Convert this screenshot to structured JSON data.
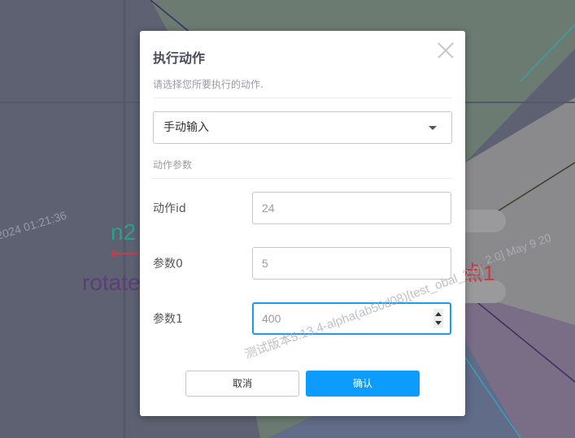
{
  "canvas": {
    "labels": {
      "n2": "n2",
      "rotate": "rotate",
      "point1": "点1",
      "arrow": "⟵"
    },
    "watermark_left": "2024 01:21:36",
    "watermark_right": "2.0] May 9 20",
    "watermark_center": "测试版本5.13.4-alpha(ab50d08)[test_obal_2.0]",
    "colors": {
      "n2": "#2aa08a",
      "rotate": "#5a3f78",
      "point1": "#c0404a"
    }
  },
  "modal": {
    "title": "执行动作",
    "subtitle": "请选择您所要执行的动作.",
    "action_select": {
      "value": "手动输入"
    },
    "section_title": "动作参数",
    "fields": [
      {
        "label": "动作id",
        "value": "24"
      },
      {
        "label": "参数0",
        "value": "5"
      },
      {
        "label": "参数1",
        "value": "400"
      }
    ],
    "cancel_label": "取消",
    "confirm_label": "确认",
    "accent": "#0d9cfb"
  }
}
